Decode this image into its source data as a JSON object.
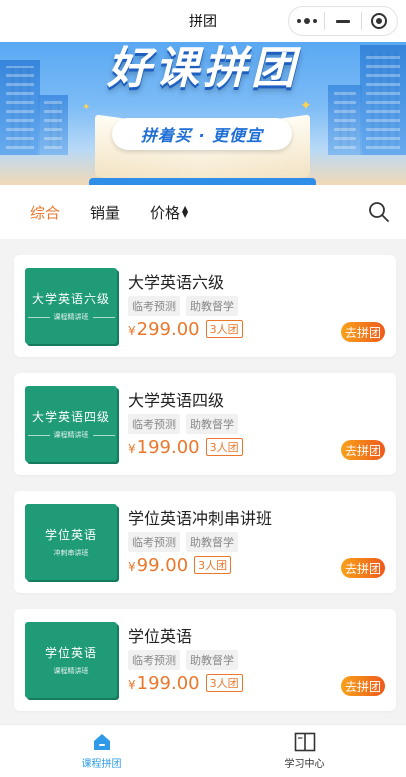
{
  "nav": {
    "title": "拼团"
  },
  "banner": {
    "title": "好课拼团",
    "slogan": "拼着买 · 更便宜"
  },
  "filters": [
    {
      "label": "综合",
      "active": true
    },
    {
      "label": "销量",
      "active": false
    },
    {
      "label": "价格",
      "active": false
    }
  ],
  "products": [
    {
      "thumb_title": "大学英语六级",
      "thumb_sub": "课程精讲班",
      "title": "大学英语六级",
      "tags": [
        "临考预测",
        "助教督学"
      ],
      "currency": "¥",
      "price": "299.00",
      "group": "3人团",
      "button": "去拼团"
    },
    {
      "thumb_title": "大学英语四级",
      "thumb_sub": "课程精讲班",
      "title": "大学英语四级",
      "tags": [
        "临考预测",
        "助教督学"
      ],
      "currency": "¥",
      "price": "199.00",
      "group": "3人团",
      "button": "去拼团"
    },
    {
      "thumb_title": "学位英语",
      "thumb_sub": "冲刺串讲班",
      "title": "学位英语冲刺串讲班",
      "tags": [
        "临考预测",
        "助教督学"
      ],
      "currency": "¥",
      "price": "99.00",
      "group": "3人团",
      "button": "去拼团"
    },
    {
      "thumb_title": "学位英语",
      "thumb_sub": "课程精讲班",
      "title": "学位英语",
      "tags": [
        "临考预测",
        "助教督学"
      ],
      "currency": "¥",
      "price": "199.00",
      "group": "3人团",
      "button": "去拼团"
    }
  ],
  "tabbar": [
    {
      "label": "课程拼团",
      "icon": "home-icon",
      "active": true
    },
    {
      "label": "学习中心",
      "icon": "book-icon",
      "active": false
    }
  ],
  "colors": {
    "accent": "#e9782c",
    "tab_active": "#2f9be8",
    "thumb_green": "#1f9b78"
  }
}
